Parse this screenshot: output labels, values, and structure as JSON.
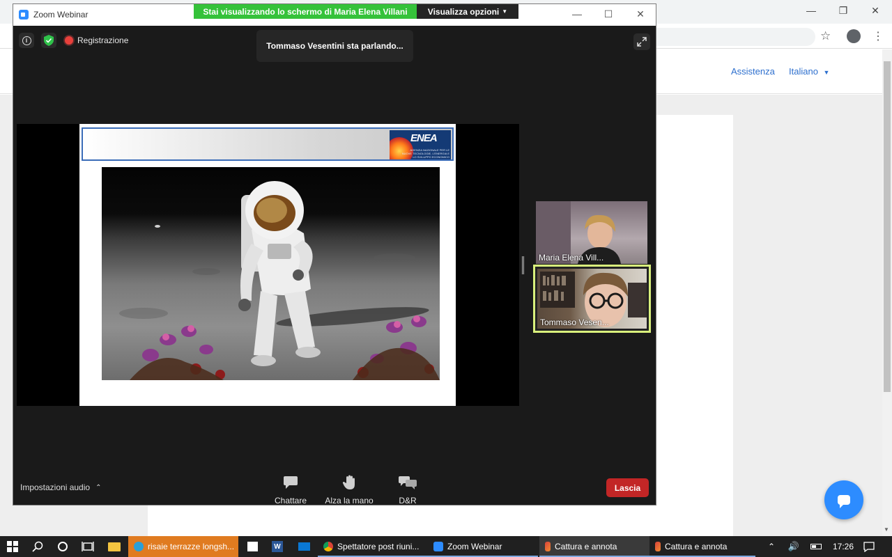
{
  "browser": {
    "links": [
      "Assistenza",
      "Italiano"
    ]
  },
  "zoom": {
    "window_title": "Zoom Webinar",
    "share_banner": {
      "status": "Stai visualizzando lo schermo di Maria Elena Villani",
      "options_label": "Visualizza opzioni"
    },
    "recording_label": "Registrazione",
    "speaking_toast": "Tommaso Vesentini sta parlando...",
    "slide": {
      "logo_text": "ENEA",
      "logo_subtitle": "AGENZIA NAZIONALE PER LE NUOVE TECNOLOGIE, L'ENERGIA E LO SVILUPPO ECONOMICO SOSTENIBILE"
    },
    "participants": [
      {
        "name": "Maria Elena Vill..."
      },
      {
        "name": "Tommaso Vesen...",
        "active_speaker": true
      }
    ],
    "audio_settings_label": "Impostazioni audio",
    "controls": [
      {
        "label": "Chattare",
        "icon": "chat-icon"
      },
      {
        "label": "Alza la mano",
        "icon": "raise-hand-icon"
      },
      {
        "label": "D&R",
        "icon": "qa-icon"
      }
    ],
    "leave_label": "Lascia",
    "colors": {
      "share_green": "#35c23a",
      "leave_red": "#c22626",
      "active_speaker_border": "#d9f07c",
      "chat_fab": "#2d8cff"
    }
  },
  "taskbar": {
    "tasks": [
      {
        "label": "risaie terrazze longsh...",
        "icon": "edge-icon"
      },
      {
        "label": "Spettatore post riuni...",
        "icon": "chrome-icon"
      },
      {
        "label": "Zoom Webinar",
        "icon": "zoom-icon"
      },
      {
        "label": "Cattura e annota",
        "icon": "snip-icon"
      },
      {
        "label": "Cattura e annota",
        "icon": "snip-icon"
      }
    ],
    "clock": "17:26"
  }
}
